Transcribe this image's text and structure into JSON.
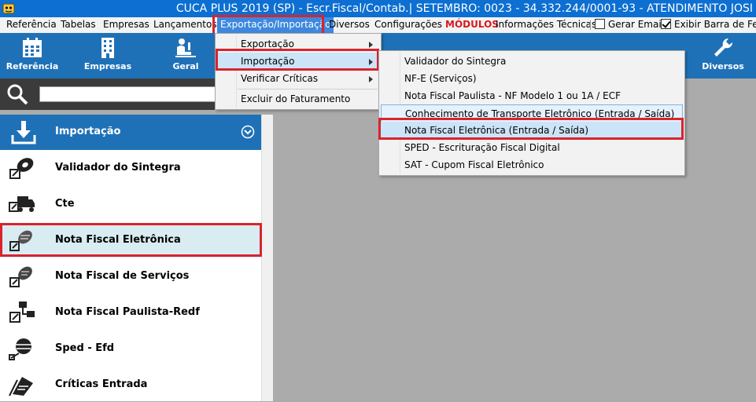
{
  "window": {
    "title": "CUCA PLUS 2019 (SP) - Escr.Fiscal/Contab.| SETEMBRO: 0023 - 34.332.244/0001-93 - ATENDIMENTO JOSI"
  },
  "menubar": {
    "items": [
      "Referência",
      "Tabelas",
      "Empresas",
      "Lançamentos",
      "Exportação/Importação",
      "Diversos",
      "Configurações",
      "MÓDULOS",
      "Informações Técnicas"
    ],
    "gerar_email": {
      "label": "Gerar Email",
      "checked": false
    },
    "exibir_barra": {
      "label": "Exibir Barra de Ferra",
      "checked": true
    }
  },
  "toolbar": {
    "buttons": [
      "Referência",
      "Empresas",
      "Geral",
      "Diversos"
    ]
  },
  "search": {
    "value": "",
    "placeholder": ""
  },
  "sidepanel": {
    "header": "Importação",
    "items": [
      "Validador do Sintegra",
      "Cte",
      "Nota Fiscal Eletrônica",
      "Nota Fiscal de Serviços",
      "Nota Fiscal Paulista-Redf",
      "Sped - Efd",
      "Críticas Entrada"
    ],
    "selected": "Nota Fiscal Eletrônica"
  },
  "menu_export_import": {
    "items": [
      "Exportação",
      "Importação",
      "Verificar Críticas",
      "Excluir do Faturamento"
    ],
    "hovered": "Importação"
  },
  "menu_importacao": {
    "items": [
      "Validador do Sintegra",
      "NF-E (Serviços)",
      "Nota Fiscal Paulista - NF Modelo 1 ou 1A / ECF",
      "Conhecimento de Transporte Eletrônico (Entrada / Saída)",
      "Nota Fiscal Eletrônica (Entrada / Saída)",
      "SPED - Escrituração Fiscal Digital",
      "SAT - Cupom Fiscal Eletrônico"
    ],
    "hovered": "Nota Fiscal Eletrônica (Entrada / Saída)"
  },
  "colors": {
    "title_bar": "#0d6fd1",
    "toolbar": "#1f71b7",
    "highlight": "#d9232e",
    "workspace": "#ababab"
  }
}
